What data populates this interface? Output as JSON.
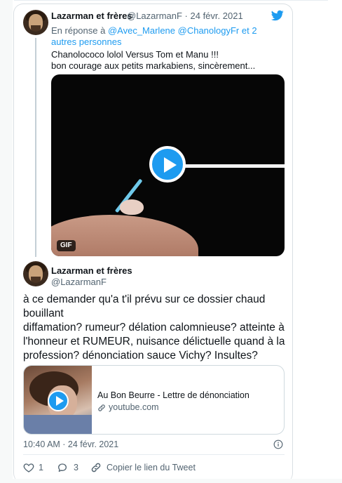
{
  "quoted_tweet": {
    "author_name": "Lazarman et frères",
    "handle_date": "@LazarmanF · 24 févr. 2021",
    "reply_prefix": "En réponse à ",
    "reply_mentions": "@Avec_Marlene @ChanologyFr",
    "reply_suffix": " et 2 autres personnes",
    "text_line1": "Chanolococo lolol Versus Tom et Manu !!!",
    "text_line2": "bon courage aux petits markabiens, sincèrement...",
    "media_badge": "GIF"
  },
  "main_tweet": {
    "author_name": "Lazarman et frères",
    "handle": "@LazarmanF",
    "text_lines": [
      "à ce demander qu'a t'il prévu sur ce dossier chaud",
      "bouillant",
      "diffamation? rumeur? délation calomnieuse? atteinte à",
      "l'honneur et RUMEUR, nuisance  délictuelle quand à la",
      "profession? dénonciation sauce Vichy? Insultes?"
    ],
    "link_card": {
      "title": "Au Bon Beurre - Lettre de dénonciation",
      "domain": "youtube.com"
    },
    "timestamp": "10:40 AM · 24 févr. 2021",
    "likes": "1",
    "replies": "3",
    "copy_link_label": "Copier le lien du Tweet"
  },
  "colors": {
    "accent": "#1d9bf0",
    "muted": "#536471",
    "text": "#0f1419"
  },
  "icons": [
    "twitter-bird-icon",
    "play-icon",
    "link-icon",
    "info-icon",
    "heart-icon",
    "reply-icon",
    "link-copy-icon"
  ]
}
